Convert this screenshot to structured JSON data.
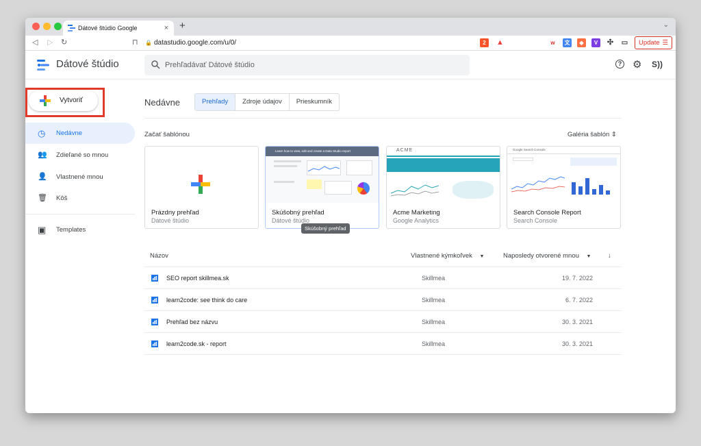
{
  "browser": {
    "tab_title": "Dátové štúdio Google",
    "tab_close": "×",
    "new_tab": "+",
    "tab_menu": "⌄",
    "url": "datastudio.google.com/u/0/",
    "brave_badge": "2",
    "update_label": "Update"
  },
  "header": {
    "app_name": "Dátové štúdio",
    "search_placeholder": "Prehľadávať Dátové štúdio",
    "help": "?",
    "settings": "⚙",
    "account": "S))"
  },
  "sidebar": {
    "create_label": "Vytvoriť",
    "items": [
      {
        "label": "Nedávne",
        "icon": "clock-icon",
        "glyph": "◷"
      },
      {
        "label": "Zdieľané so mnou",
        "icon": "people-icon",
        "glyph": "👥"
      },
      {
        "label": "Vlastnené mnou",
        "icon": "person-icon",
        "glyph": "👤"
      },
      {
        "label": "Kôš",
        "icon": "trash-icon",
        "glyph": "🗑"
      },
      {
        "label": "Templates",
        "icon": "templates-icon",
        "glyph": "▣"
      }
    ]
  },
  "main": {
    "title": "Nedávne",
    "tabs": [
      "Prehľady",
      "Zdroje údajov",
      "Prieskumník"
    ],
    "templates_heading": "Začať šablónou",
    "gallery_label": "Galéria šablón",
    "gallery_icon": "⇕",
    "templates": [
      {
        "title": "Prázdny prehľad",
        "subtitle": "Dátové štúdio"
      },
      {
        "title": "Skúšobný prehľad",
        "subtitle": "Dátové štúdio",
        "thumb_text": "Learn how to view, edit and create a Data Studio report"
      },
      {
        "title": "Acme Marketing",
        "subtitle": "Google Analytics",
        "thumb_text": "ACME"
      },
      {
        "title": "Search Console Report",
        "subtitle": "Search Console",
        "thumb_text": "Google Search Console"
      }
    ],
    "tooltip": "Skúšobný prehľad"
  },
  "table": {
    "col_name": "Názov",
    "col_owner": "Vlastnené kýmkoľvek",
    "col_opened": "Naposledy otvorené mnou",
    "sort_icon": "↓",
    "rows": [
      {
        "name": "SEO report skillmea.sk",
        "owner": "Skillmea",
        "date": "19. 7. 2022"
      },
      {
        "name": "learn2code: see think do care",
        "owner": "Skillmea",
        "date": "6. 7. 2022"
      },
      {
        "name": "Prehľad bez názvu",
        "owner": "Skillmea",
        "date": "30. 3. 2021"
      },
      {
        "name": "learn2code.sk - report",
        "owner": "Skillmea",
        "date": "30. 3. 2021"
      }
    ]
  },
  "colors": {
    "accent": "#1a73e8",
    "highlight_box": "#e03b2a"
  }
}
